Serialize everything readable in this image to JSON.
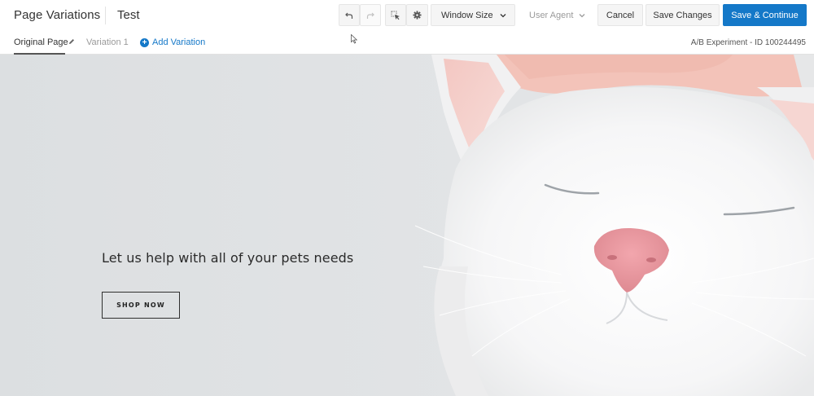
{
  "header": {
    "app_title": "Page Variations",
    "page_name": "Test"
  },
  "toolbar": {
    "undo_icon": "undo-icon",
    "redo_icon": "redo-icon",
    "select_icon": "element-select-icon",
    "settings_icon": "gear-icon",
    "window_size_label": "Window Size",
    "user_agent_label": "User Agent",
    "cancel_label": "Cancel",
    "save_label": "Save Changes",
    "continue_label": "Save & Continue"
  },
  "tabs": {
    "original_label": "Original Page",
    "variation_label": "Variation 1",
    "add_variation_label": "Add Variation",
    "experiment_label": "A/B Experiment - ID 100244495"
  },
  "preview": {
    "headline": "Let us help with all of your pets needs",
    "cta_label": "SHOP NOW"
  },
  "colors": {
    "accent": "#1478c8",
    "hero_background": "#dfe1e3"
  }
}
